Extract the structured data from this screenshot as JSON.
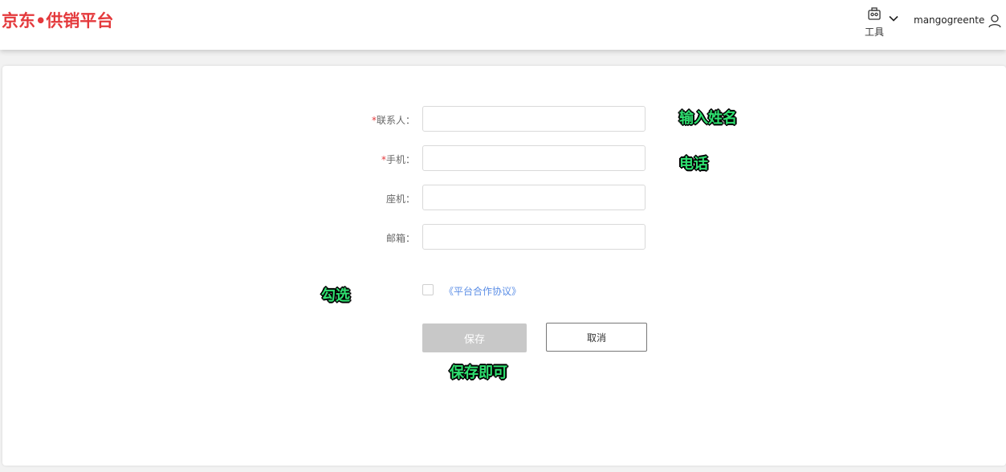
{
  "header": {
    "logo_text": "京东•供销平台",
    "tools_label": "工具",
    "tools_icon": "toolbox-icon",
    "tools_chevron_icon": "chevron-down-icon",
    "username": "mangogreente",
    "user_icon": "user-icon"
  },
  "form": {
    "fields": [
      {
        "label": "联系人：",
        "required": true,
        "required_mark": "*",
        "value": "",
        "placeholder": ""
      },
      {
        "label": "手机：",
        "required": true,
        "required_mark": "*",
        "value": "",
        "placeholder": ""
      },
      {
        "label": "座机：",
        "required": false,
        "value": "",
        "placeholder": ""
      },
      {
        "label": "邮箱：",
        "required": false,
        "value": "",
        "placeholder": ""
      }
    ],
    "agreement": {
      "checked": false,
      "link_text": "《平台合作协议》"
    },
    "save_label": "保存",
    "cancel_label": "取消"
  },
  "annotations": {
    "name_hint": "输入姓名",
    "phone_hint": "电话",
    "check_hint": "勾选",
    "save_hint": "保存即可"
  },
  "colors": {
    "brand": "#e4393c",
    "link": "#5b8ee6",
    "annotation": "#2fe070",
    "disabled_button": "#c8c8c8"
  }
}
